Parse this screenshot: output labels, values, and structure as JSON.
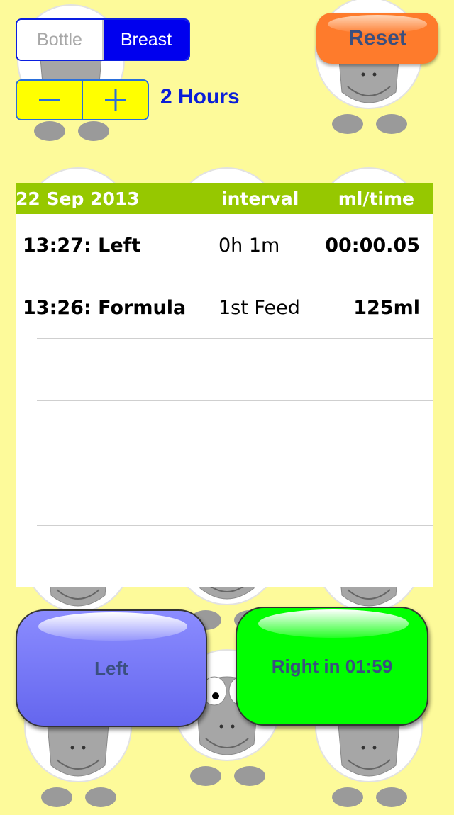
{
  "feed_type": {
    "options": [
      "Bottle",
      "Breast"
    ],
    "selected": "Breast"
  },
  "interval": {
    "minus_icon": "minus-icon",
    "plus_icon": "plus-icon",
    "label": "2 Hours"
  },
  "reset": {
    "label": "Reset"
  },
  "log": {
    "headers": {
      "date": "22 Sep 2013",
      "interval": "interval",
      "value": "ml/time"
    },
    "rows": [
      {
        "label": "13:27: Left",
        "interval": "0h 1m",
        "value": "00:00.05"
      },
      {
        "label": "13:26: Formula",
        "interval": "1st Feed",
        "value": "125ml"
      }
    ],
    "empty_rows": 4
  },
  "actions": {
    "left": {
      "label": "Left"
    },
    "right": {
      "label": "Right in 01:59"
    }
  },
  "colors": {
    "background": "#fdfa9a",
    "segment_selected": "#0000ee",
    "stepper": "#ffff00",
    "reset": "#fe7b2c",
    "table_header": "#96c800",
    "left_button": "#7b7cff",
    "right_button": "#00ff00"
  }
}
